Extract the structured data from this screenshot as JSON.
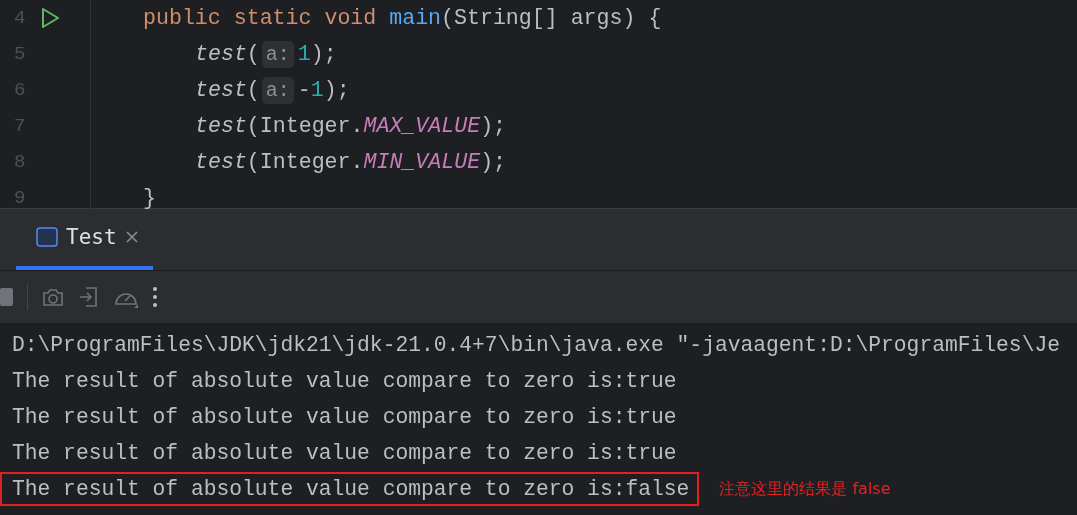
{
  "editor": {
    "lines": [
      {
        "number": "4",
        "run": true,
        "kind": "member",
        "tokens": [
          {
            "kind": "keyword",
            "text": "public static void "
          },
          {
            "kind": "method",
            "text": "main"
          },
          {
            "kind": "plain",
            "text": "(String[] args) {"
          }
        ]
      },
      {
        "number": "5",
        "run": false,
        "kind": "body",
        "tokens": [
          {
            "kind": "call",
            "text": "test"
          },
          {
            "kind": "plain",
            "text": "("
          },
          {
            "kind": "hint",
            "text": "a:"
          },
          {
            "kind": "number",
            "text": "1"
          },
          {
            "kind": "plain",
            "text": ");"
          }
        ]
      },
      {
        "number": "6",
        "run": false,
        "kind": "body",
        "tokens": [
          {
            "kind": "call",
            "text": "test"
          },
          {
            "kind": "plain",
            "text": "("
          },
          {
            "kind": "hint",
            "text": "a:"
          },
          {
            "kind": "plain",
            "text": "-"
          },
          {
            "kind": "number",
            "text": "1"
          },
          {
            "kind": "plain",
            "text": ");"
          }
        ]
      },
      {
        "number": "7",
        "run": false,
        "kind": "body",
        "tokens": [
          {
            "kind": "call",
            "text": "test"
          },
          {
            "kind": "plain",
            "text": "(Integer."
          },
          {
            "kind": "constant",
            "text": "MAX_VALUE"
          },
          {
            "kind": "plain",
            "text": ");"
          }
        ]
      },
      {
        "number": "8",
        "run": false,
        "kind": "body",
        "tokens": [
          {
            "kind": "call",
            "text": "test"
          },
          {
            "kind": "plain",
            "text": "(Integer."
          },
          {
            "kind": "constant",
            "text": "MIN_VALUE"
          },
          {
            "kind": "plain",
            "text": ");"
          }
        ]
      },
      {
        "number": "9",
        "run": false,
        "kind": "member",
        "tokens": [
          {
            "kind": "plain",
            "text": "}"
          }
        ]
      }
    ]
  },
  "run_panel": {
    "tabs": [
      {
        "label": "Test",
        "selected": true
      }
    ]
  },
  "console": {
    "lines": [
      {
        "text": "D:\\ProgramFiles\\JDK\\jdk21\\jdk-21.0.4+7\\bin\\java.exe \"-javaagent:D:\\ProgramFiles\\Je",
        "boxed": false
      },
      {
        "text": "The result of absolute value compare to zero is:true",
        "boxed": false
      },
      {
        "text": "The result of absolute value compare to zero is:true",
        "boxed": false
      },
      {
        "text": "The result of absolute value compare to zero is:true",
        "boxed": false
      },
      {
        "text": "The result of absolute value compare to zero is:false",
        "boxed": true
      }
    ],
    "annotation": "注意这里的结果是 false"
  }
}
